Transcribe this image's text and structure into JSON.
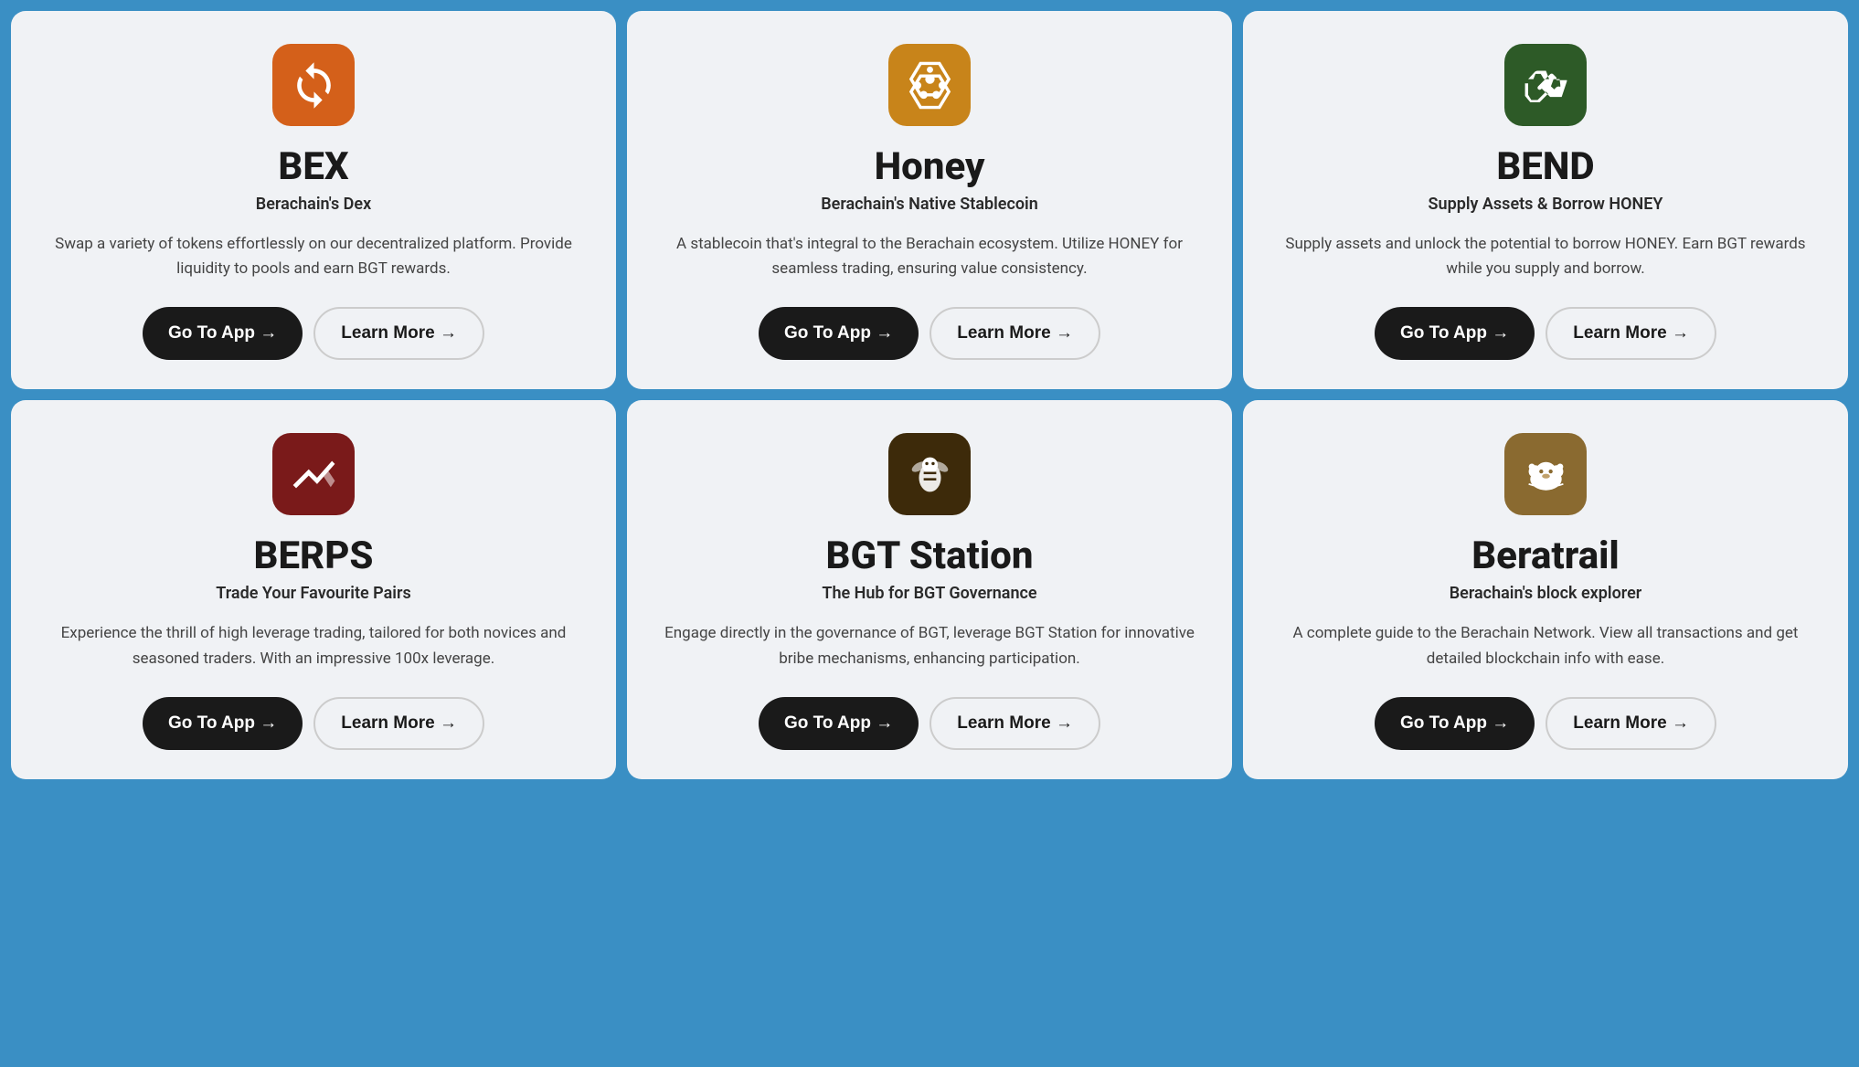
{
  "cards": [
    {
      "id": "bex",
      "icon_name": "bex-icon",
      "icon_bg": "#d4601a",
      "icon_type": "swap",
      "title": "BEX",
      "subtitle": "Berachain's Dex",
      "description": "Swap a variety of tokens effortlessly on our decentralized platform. Provide liquidity to pools and earn BGT rewards.",
      "go_to_app": "Go To App →",
      "learn_more": "Learn More →"
    },
    {
      "id": "honey",
      "icon_name": "honey-icon",
      "icon_bg": "#c8841a",
      "icon_type": "honeycomb",
      "title": "Honey",
      "subtitle": "Berachain's Native Stablecoin",
      "description": "A stablecoin that's integral to the Berachain ecosystem. Utilize HONEY for seamless trading, ensuring value consistency.",
      "go_to_app": "Go To App →",
      "learn_more": "Learn More →"
    },
    {
      "id": "bend",
      "icon_name": "bend-icon",
      "icon_bg": "#2d5a27",
      "icon_type": "handshake",
      "title": "BEND",
      "subtitle": "Supply Assets & Borrow HONEY",
      "description": "Supply assets and unlock the potential to borrow HONEY. Earn BGT rewards while you supply and borrow.",
      "go_to_app": "Go To App →",
      "learn_more": "Learn More →"
    },
    {
      "id": "berps",
      "icon_name": "berps-icon",
      "icon_bg": "#7a1a1a",
      "icon_type": "chart",
      "title": "BERPS",
      "subtitle": "Trade Your Favourite Pairs",
      "description": "Experience the thrill of high leverage trading, tailored for both novices and seasoned traders. With an impressive 100x leverage.",
      "go_to_app": "Go To App →",
      "learn_more": "Learn More →"
    },
    {
      "id": "bgt",
      "icon_name": "bgt-station-icon",
      "icon_bg": "#3d2a0a",
      "icon_type": "bee",
      "title": "BGT Station",
      "subtitle": "The Hub for BGT Governance",
      "description": "Engage directly in the governance of BGT, leverage BGT Station for innovative bribe mechanisms, enhancing participation.",
      "go_to_app": "Go To App →",
      "learn_more": "Learn More →"
    },
    {
      "id": "beratrail",
      "icon_name": "beratrail-icon",
      "icon_bg": "#8a6a30",
      "icon_type": "bear",
      "title": "Beratrail",
      "subtitle": "Berachain's block explorer",
      "description": "A complete guide to the Berachain Network. View all transactions and get detailed blockchain info with ease.",
      "go_to_app": "Go To App →",
      "learn_more": "Learn More →"
    }
  ]
}
